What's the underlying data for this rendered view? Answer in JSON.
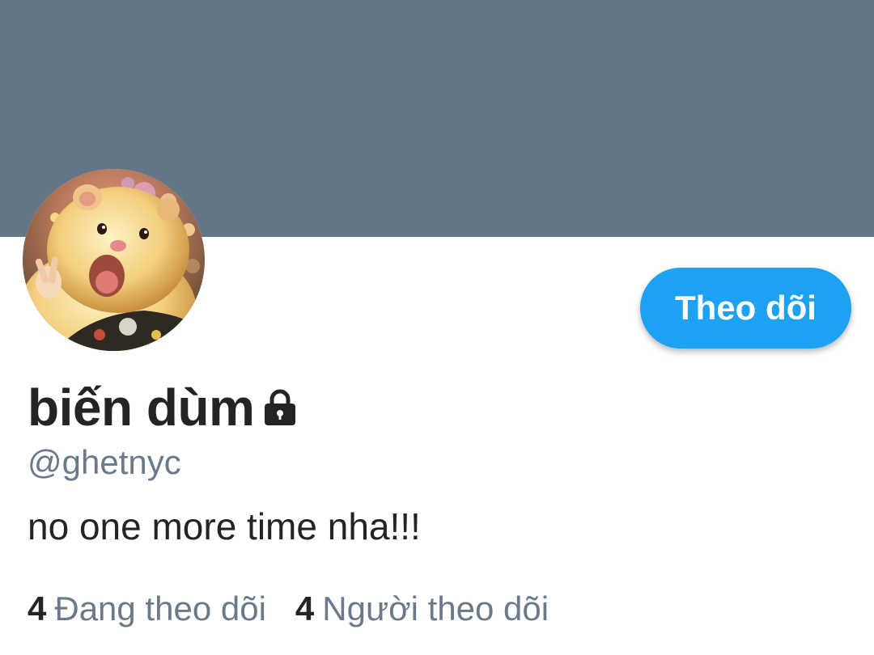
{
  "colors": {
    "banner": "#657786",
    "accent": "#1da1f2",
    "text_primary": "#222426",
    "text_secondary": "#6a7a8a"
  },
  "profile": {
    "display_name": "biến dùm",
    "handle": "@ghetnyc",
    "bio": "no one more time nha!!!",
    "locked_icon": "lock-icon",
    "avatar": "hamster-photo"
  },
  "actions": {
    "follow_label": "Theo dõi"
  },
  "stats": [
    {
      "count": "4",
      "label": "Đang theo dõi"
    },
    {
      "count": "4",
      "label": "Người theo dõi"
    }
  ]
}
